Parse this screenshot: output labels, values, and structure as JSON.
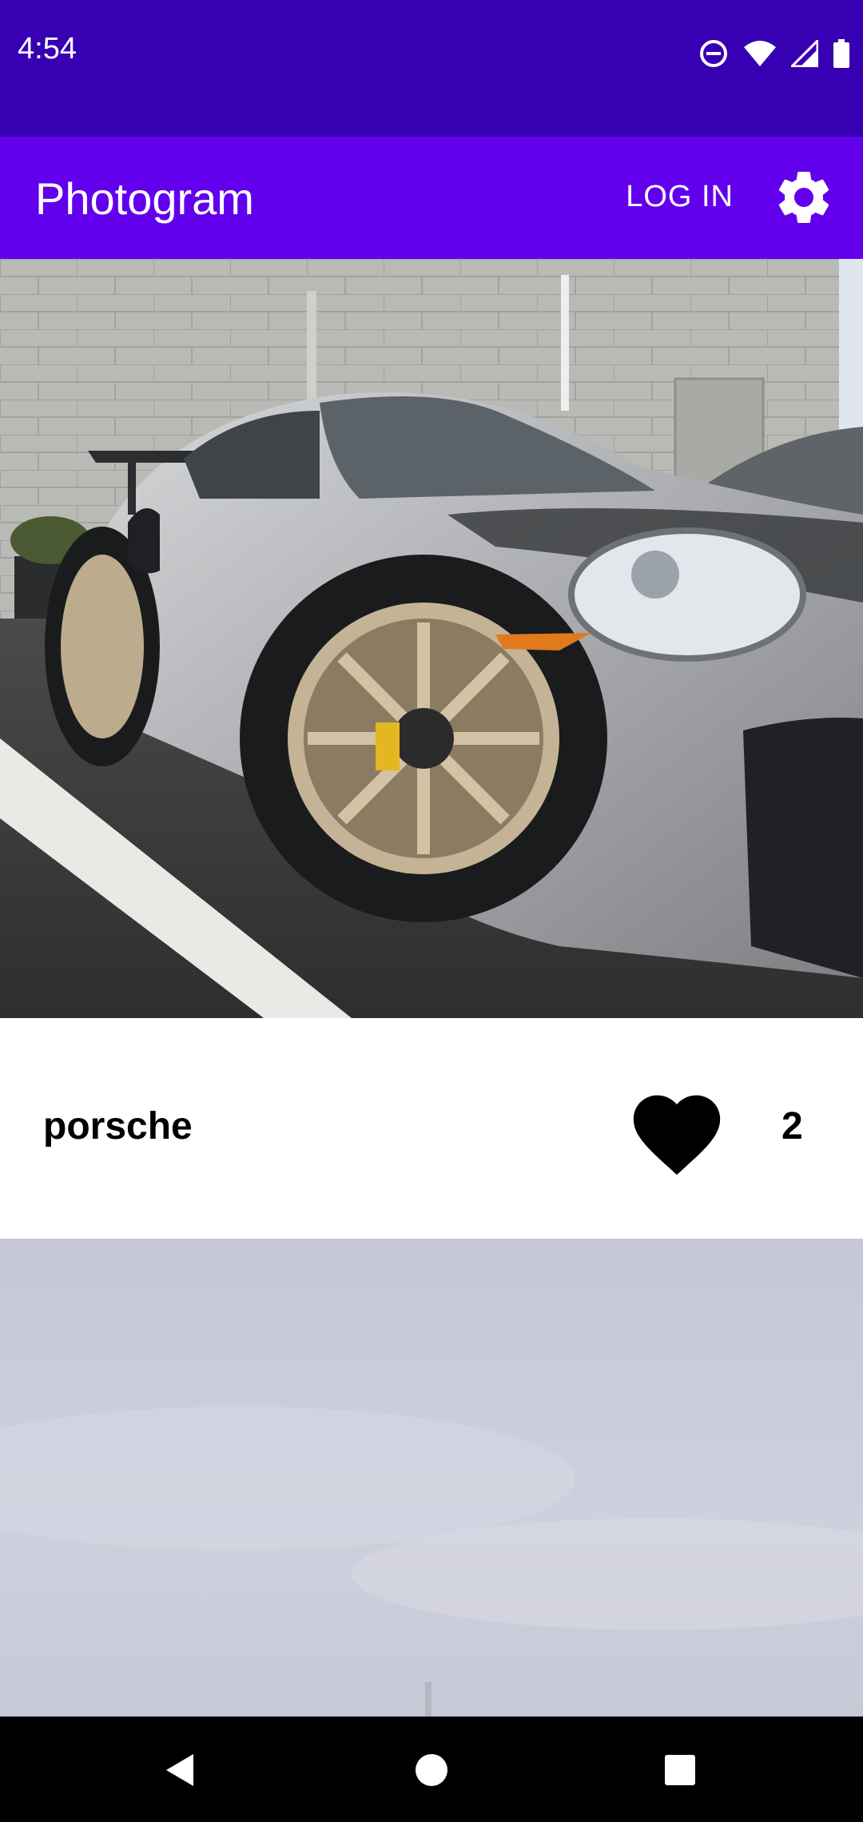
{
  "status_bar": {
    "time": "4:54",
    "icons": [
      "do-not-disturb-icon",
      "wifi-icon",
      "cellular-signal-icon",
      "battery-icon"
    ]
  },
  "app_bar": {
    "title": "Photogram",
    "login_label": "LOG IN",
    "settings_icon": "gear-icon"
  },
  "feed": {
    "posts": [
      {
        "username": "porsche",
        "like_icon": "heart-icon",
        "likes": "2"
      }
    ]
  },
  "nav_bar": {
    "buttons": [
      "back-icon",
      "home-icon",
      "recents-icon"
    ]
  },
  "colors": {
    "status_bar": "#3700b3",
    "app_bar": "#6200ee",
    "nav_bar": "#000000"
  }
}
